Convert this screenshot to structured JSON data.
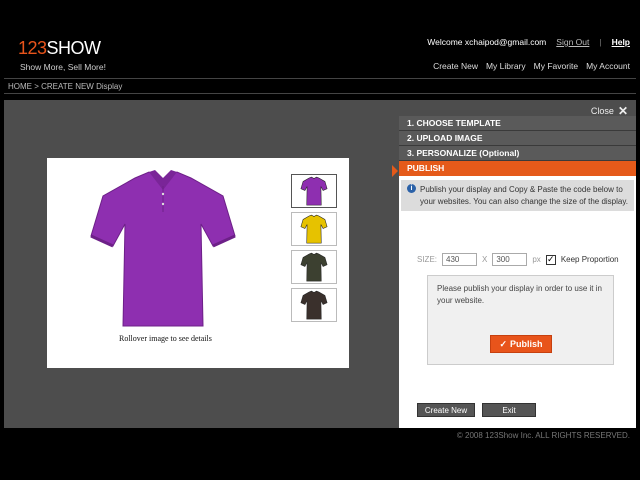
{
  "header": {
    "logo_number": "123",
    "logo_word": "SHOW",
    "tagline": "Show More, Sell More!",
    "welcome": "Welcome xchaipod@gmail.com",
    "sign_out": "Sign Out",
    "separator": "|",
    "help": "Help",
    "nav": [
      "Create New",
      "My Library",
      "My Favorite",
      "My Account"
    ]
  },
  "breadcrumb": "HOME > CREATE NEW Display",
  "close_label": "Close",
  "close_glyph": "✕",
  "preview": {
    "caption": "Rollover image to see details",
    "main_color": "#8e2fb0",
    "thumbnails": [
      {
        "color": "#8e2fb0"
      },
      {
        "color": "#e6c200"
      },
      {
        "color": "#3c4030"
      },
      {
        "color": "#3a302c"
      }
    ]
  },
  "steps": [
    "1.  CHOOSE TEMPLATE",
    "2.  UPLOAD IMAGE",
    "3.  PERSONALIZE (Optional)",
    "PUBLISH"
  ],
  "info_icon": "i",
  "info_text": "Publish your display and Copy & Paste the code below to your websites. You can also change the size of the display.",
  "size": {
    "label": "SIZE:",
    "width": "430",
    "sep": "X",
    "height": "300",
    "unit": "px",
    "keep_checked": true,
    "check_glyph": "✓",
    "keep_label": "Keep Proportion"
  },
  "publish_box_text": "Please publish your display in order to use it in your website.",
  "publish_button": "Publish",
  "publish_glyph": "✓",
  "create_new_button": "Create New",
  "exit_button": "Exit",
  "footer": "© 2008 123Show Inc. ALL RIGHTS RESERVED.",
  "colors": {
    "accent": "#e55a1a",
    "background": "#000000",
    "workspace": "#4d4d4d"
  }
}
